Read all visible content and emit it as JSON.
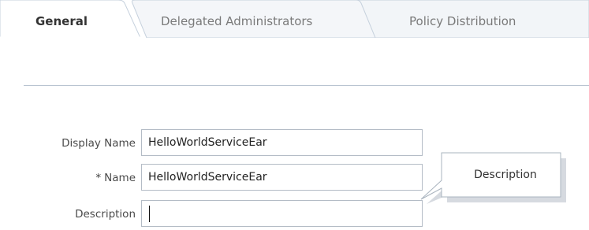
{
  "tabs": [
    {
      "label": "General",
      "selected": true
    },
    {
      "label": "Delegated Administrators",
      "selected": false
    },
    {
      "label": "Policy Distribution",
      "selected": false
    }
  ],
  "form": {
    "display_name": {
      "label": "Display Name",
      "value": "HelloWorldServiceEar",
      "required": false
    },
    "name": {
      "label": "Name",
      "required_marker": "*",
      "value": "HelloWorldServiceEar",
      "required": true
    },
    "description": {
      "label": "Description",
      "value": "",
      "focused": true
    }
  },
  "tooltip": {
    "text": "Description"
  },
  "colors": {
    "tab_border": "#c6d1dd",
    "tab_unselected_bg": "#f2f5f8",
    "divider": "#b9c4d1",
    "input_border": "#b4bcc6",
    "tooltip_border": "#aab4bf"
  }
}
